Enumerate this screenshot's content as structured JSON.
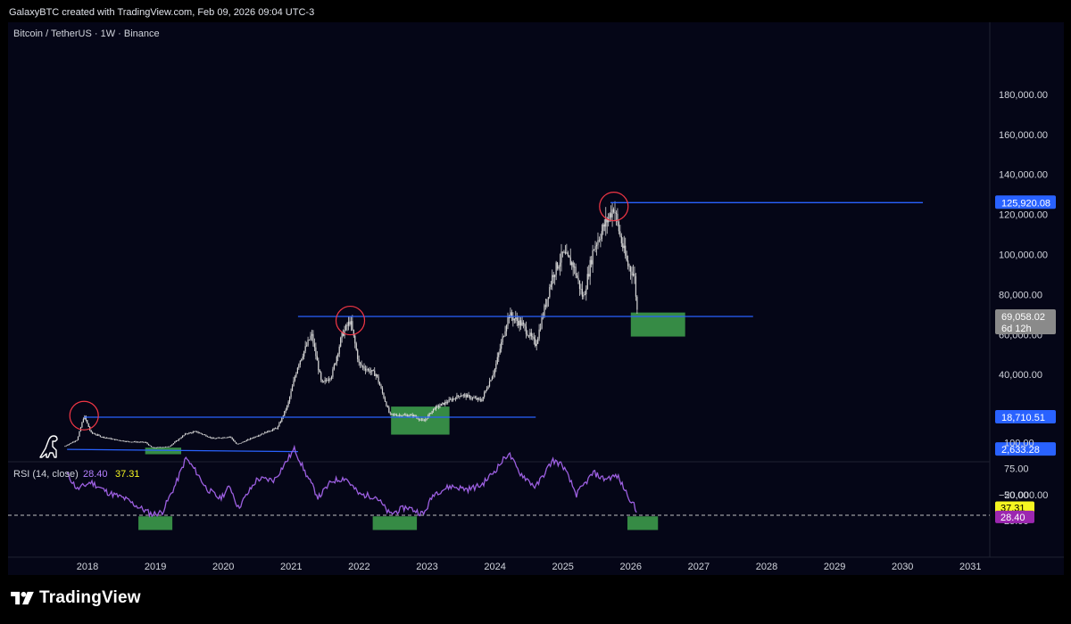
{
  "caption": "GalaxyBTC created with TradingView.com, Feb 09, 2026 09:04 UTC-3",
  "brand": "TradingView",
  "colors": {
    "background": "#050617",
    "candles": "#d7d7d7",
    "level_lines": "#2962ff",
    "accumulation_zone": "#3fa34d",
    "top_circle": "#f23645",
    "rsi_line": "#9c5fe0",
    "price_badge": "#2962ff",
    "last_price_badge": "#8a8a8a",
    "rsi_badge_value": "#9c27b0",
    "rsi_badge_ma": "#f5f521"
  },
  "chart_data": [
    {
      "type": "candlestick",
      "title": "Bitcoin / TetherUS · 1W · Binance",
      "y_axis": {
        "ticks": [
          "180,000.00",
          "160,000.00",
          "140,000.00",
          "120,000.00",
          "100,000.00",
          "80,000.00",
          "60,000.00",
          "40,000.00",
          "20,000.00",
          "−20,000.00"
        ],
        "tick_values": [
          180000,
          160000,
          140000,
          120000,
          100000,
          80000,
          60000,
          40000,
          20000,
          -20000
        ],
        "badges": [
          {
            "label": "125,920.08",
            "value": 125920.08,
            "style": "blue"
          },
          {
            "label": "69,058.02",
            "sub": "6d 12h",
            "value": 69058.02,
            "style": "gray"
          },
          {
            "label": "18,710.51",
            "value": 18710.51,
            "style": "blue"
          },
          {
            "label": "2,633.28",
            "value": 2633.28,
            "style": "blue"
          }
        ]
      },
      "x_axis": {
        "labels": [
          "2018",
          "2019",
          "2020",
          "2021",
          "2022",
          "2023",
          "2024",
          "2025",
          "2026",
          "2027",
          "2028",
          "2029",
          "2030",
          "2031"
        ],
        "label_dates": [
          2018.0,
          2019.0,
          2020.0,
          2021.0,
          2022.0,
          2023.0,
          2024.0,
          2025.0,
          2026.0,
          2027.0,
          2028.0,
          2029.0,
          2030.0,
          2031.0
        ]
      },
      "price_path": [
        [
          2017.67,
          4300
        ],
        [
          2017.85,
          7500
        ],
        [
          2017.95,
          19500
        ],
        [
          2018.05,
          11000
        ],
        [
          2018.2,
          9000
        ],
        [
          2018.4,
          7500
        ],
        [
          2018.6,
          6500
        ],
        [
          2018.85,
          6200
        ],
        [
          2018.95,
          3500
        ],
        [
          2019.2,
          4000
        ],
        [
          2019.45,
          10500
        ],
        [
          2019.6,
          11500
        ],
        [
          2019.85,
          8000
        ],
        [
          2020.1,
          9000
        ],
        [
          2020.2,
          5000
        ],
        [
          2020.5,
          9500
        ],
        [
          2020.8,
          13500
        ],
        [
          2020.95,
          25000
        ],
        [
          2021.1,
          45000
        ],
        [
          2021.3,
          60000
        ],
        [
          2021.45,
          35000
        ],
        [
          2021.6,
          40000
        ],
        [
          2021.75,
          60000
        ],
        [
          2021.87,
          67000
        ],
        [
          2022.0,
          45000
        ],
        [
          2022.25,
          40000
        ],
        [
          2022.45,
          20000
        ],
        [
          2022.8,
          19500
        ],
        [
          2022.95,
          16500
        ],
        [
          2023.1,
          23000
        ],
        [
          2023.5,
          30000
        ],
        [
          2023.8,
          27000
        ],
        [
          2024.0,
          43000
        ],
        [
          2024.2,
          70000
        ],
        [
          2024.4,
          65000
        ],
        [
          2024.6,
          55000
        ],
        [
          2024.85,
          90000
        ],
        [
          2025.0,
          100000
        ],
        [
          2025.15,
          95000
        ],
        [
          2025.3,
          78000
        ],
        [
          2025.45,
          103000
        ],
        [
          2025.55,
          110000
        ],
        [
          2025.75,
          124000
        ],
        [
          2025.85,
          108000
        ],
        [
          2025.95,
          95000
        ],
        [
          2026.05,
          90000
        ],
        [
          2026.1,
          69058
        ]
      ],
      "tops": [
        {
          "date": 2017.95,
          "price": 19500
        },
        {
          "date": 2021.87,
          "price": 67000
        },
        {
          "date": 2025.75,
          "price": 124000
        }
      ],
      "levels": [
        {
          "price": 125920.08,
          "from": 2025.7,
          "to": 2030.3
        },
        {
          "price": 69058.02,
          "from": 2021.1,
          "to": 2027.8
        },
        {
          "price": 18710.51,
          "from": 2017.95,
          "to": 2024.6
        },
        {
          "price_start": 2633.28,
          "price_end": 1500,
          "from": 2017.7,
          "to": 2021.1
        }
      ],
      "zones": [
        {
          "from": 2018.85,
          "to": 2019.38,
          "price_top": 3500,
          "price_bottom": 200
        },
        {
          "from": 2022.47,
          "to": 2023.33,
          "price_top": 24000,
          "price_bottom": 10000
        },
        {
          "from": 2026.0,
          "to": 2026.8,
          "price_top": 71000,
          "price_bottom": 59000
        }
      ]
    },
    {
      "type": "line",
      "title": "RSI (14, close)",
      "legend_values": [
        "28.40",
        "37.31"
      ],
      "ylim": [
        0,
        100
      ],
      "y_axis": {
        "ticks": [
          "100.00",
          "75.00",
          "50.00",
          "25.00"
        ],
        "tick_values": [
          100,
          75,
          50,
          25
        ],
        "badges": [
          {
            "label": "37.31",
            "value": 37.31,
            "style": "yellow"
          },
          {
            "label": "28.40",
            "value": 28.4,
            "style": "purple"
          }
        ]
      },
      "oversold_level": 30,
      "series": [
        {
          "values": [
            [
              2017.7,
              70
            ],
            [
              2017.85,
              55
            ],
            [
              2018.05,
              62
            ],
            [
              2018.3,
              52
            ],
            [
              2018.55,
              46
            ],
            [
              2018.75,
              38
            ],
            [
              2018.95,
              31
            ],
            [
              2019.1,
              33
            ],
            [
              2019.3,
              60
            ],
            [
              2019.45,
              85
            ],
            [
              2019.6,
              72
            ],
            [
              2019.75,
              56
            ],
            [
              2019.95,
              46
            ],
            [
              2020.1,
              58
            ],
            [
              2020.22,
              37
            ],
            [
              2020.5,
              65
            ],
            [
              2020.75,
              64
            ],
            [
              2020.95,
              84
            ],
            [
              2021.05,
              94
            ],
            [
              2021.2,
              72
            ],
            [
              2021.4,
              47
            ],
            [
              2021.6,
              63
            ],
            [
              2021.8,
              66
            ],
            [
              2022.0,
              50
            ],
            [
              2022.25,
              48
            ],
            [
              2022.45,
              31
            ],
            [
              2022.7,
              38
            ],
            [
              2022.95,
              31
            ],
            [
              2023.1,
              51
            ],
            [
              2023.35,
              58
            ],
            [
              2023.6,
              55
            ],
            [
              2023.8,
              59
            ],
            [
              2024.0,
              73
            ],
            [
              2024.2,
              90
            ],
            [
              2024.35,
              72
            ],
            [
              2024.6,
              57
            ],
            [
              2024.85,
              83
            ],
            [
              2025.0,
              78
            ],
            [
              2025.2,
              50
            ],
            [
              2025.45,
              71
            ],
            [
              2025.6,
              65
            ],
            [
              2025.8,
              68
            ],
            [
              2025.95,
              50
            ],
            [
              2026.05,
              39
            ],
            [
              2026.1,
              28.4
            ]
          ]
        }
      ],
      "zones": [
        {
          "from": 2018.75,
          "to": 2019.25
        },
        {
          "from": 2022.2,
          "to": 2022.85
        },
        {
          "from": 2025.95,
          "to": 2026.4
        }
      ]
    }
  ]
}
